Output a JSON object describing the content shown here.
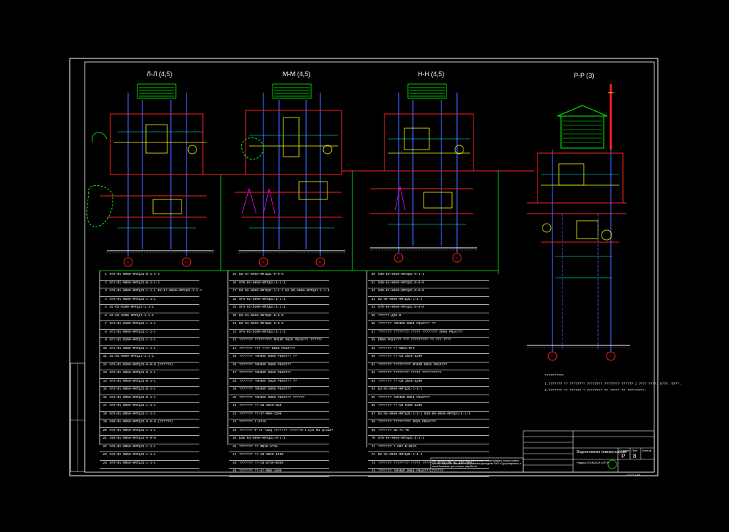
{
  "sections": [
    {
      "title": "Л-Л (4,5)"
    },
    {
      "title": "М-М (4,5)"
    },
    {
      "title": "Н-Н (4,5)"
    },
    {
      "title": "Р-Р (3)"
    }
  ],
  "axis_labels": [
    "12",
    "12",
    "13",
    "13",
    "11",
    "11",
    "7",
    "7"
  ],
  "legend_col1": [
    {
      "n": "1",
      "t": "070-01-0080-0М7Ц31-В-1-1-1"
    },
    {
      "n": "2",
      "t": "0Г2-01-0080-0М7Ц31-В-1-1-1"
    },
    {
      "n": "3",
      "t": "070-01-0080-0М7Ц31-1-1-1 Б2-07-0050-0М7Ц31-1-1-1"
    },
    {
      "n": "4",
      "t": "070-01-0080-0М7Ц31-1-1-1"
    },
    {
      "n": "5",
      "t": "Б2-01-0200-0М7Ц31-1-1-1"
    },
    {
      "n": "6",
      "t": "Б2-01-0200-0М7Ц31-1-1-1"
    },
    {
      "n": "7",
      "t": "0Г2-01-0100-0М7Ц31-1-1-1"
    },
    {
      "n": "8",
      "t": "0Г2-01-0080-0М7Ц31-1-1-1"
    },
    {
      "n": "9",
      "t": "0Г7-01-0200-0М7Ц31-1-1-1"
    },
    {
      "n": "10",
      "t": "0Г2-01-0080-0М7Ц31-1-1-1"
    },
    {
      "n": "11",
      "t": "Б2-01-0050-0М7Ц31-1-1-1"
    },
    {
      "n": "12",
      "t": "0Г6-01-0200-0М7Ц31-0-0-0 (??????)"
    },
    {
      "n": "13",
      "t": "0Г6-01-0050-0М7Ц31-В-1-1"
    },
    {
      "n": "14",
      "t": "0Г6-01-0050-0М7Ц31-В-1-1"
    },
    {
      "n": "15",
      "t": "0Г6-01-0050-0М7Ц31-В-1-1"
    },
    {
      "n": "16",
      "t": "0Г6-01-0050-0М7Ц31-В-1-1"
    },
    {
      "n": "17",
      "t": "070-01-0050-0М7Ц31-1-1-1"
    },
    {
      "n": "18",
      "t": "0Г8-01-0050-0М7Ц31-1-1-1"
    },
    {
      "n": "19",
      "t": "030-01-0050-0М7Ц31-0-0-0 (??????)"
    },
    {
      "n": "20",
      "t": "070-01-0050-0М7Ц31-1-1-1"
    },
    {
      "n": "21",
      "t": "030-01-0050-0М7Ц31-0-0-0"
    },
    {
      "n": "22",
      "t": "070-01-0050-0М7Ц31-1-1-1"
    },
    {
      "n": "23",
      "t": "0Г6-01-0050-0М7Ц31-1-1-1"
    },
    {
      "n": "24",
      "t": "070-01-0050-0М7Ц31-1-1-1"
    }
  ],
  "legend_col2": [
    {
      "n": "25",
      "t": "Б2-07-0050-0М7Ц31-0-0-0"
    },
    {
      "n": "26",
      "t": "070-01-0050-0М7Ц31-1-1-1"
    },
    {
      "n": "27",
      "t": "Б2-02-0050-0М7Ц31-1-1-1 Б2-02-0050-0М7Ц31-1-1-1"
    },
    {
      "n": "28",
      "t": "0Г6-01-0050-0М7Ц31-1-1-1"
    },
    {
      "n": "29",
      "t": "0Г6-01-0200-0М7Ц31-1-1-1"
    },
    {
      "n": "30",
      "t": "Б2-01-0050-0М7Ц31-0-0-0"
    },
    {
      "n": "31",
      "t": "Б2-01-0050-0М7Ц31-0-0-0"
    },
    {
      "n": "32",
      "t": "0Г6-01-0200-0М7Ц31-1-1-1"
    },
    {
      "n": "33",
      "t": "??????? ????????? 0П40П DN25 PN16??? ??????"
    },
    {
      "n": "34",
      "t": "??????? ??? ???? DN25 PN16???"
    },
    {
      "n": "35",
      "t": "??????? ?0П40П DN50 PN16??? ??"
    },
    {
      "n": "36",
      "t": "??????? ?0П40П DN50 PN16???"
    },
    {
      "n": "37",
      "t": "??????? ?0П40П DN20 PN16???"
    },
    {
      "n": "38",
      "t": "??????? ?0П40П DN20 PN16??? ??"
    },
    {
      "n": "39",
      "t": "??????? ?0П40П DN50 PN16???"
    },
    {
      "n": "40",
      "t": "??????? ?0П40П DN50 PN16??? ??????"
    },
    {
      "n": "41",
      "t": "??????? ??-СВ-3920-Б50"
    },
    {
      "n": "42",
      "t": "??????? ??-57-Ф80-1200"
    },
    {
      "n": "43",
      "t": "??????? С-5715"
    },
    {
      "n": "44",
      "t": "??????? Ф-?1-?12Ц ??????? 7??7??9-1 Ц=6 Ф1 Ц=125?"
    },
    {
      "n": "45",
      "t": "Б30-03-0050-0М7Ц31-0-1-1"
    },
    {
      "n": "46",
      "t": "??????? ?? ФВ15-5715"
    },
    {
      "n": "47",
      "t": "??????? ??-СВ-3920-1400"
    },
    {
      "n": "48",
      "t": "??????? ??-СВ-6730-Ф350"
    },
    {
      "n": "49",
      "t": "??????? ??-57-Ф80-1400"
    }
  ],
  "legend_col3": [
    {
      "n": "50",
      "t": "030-05-0050-0М7Ц31-0-1-1"
    },
    {
      "n": "51",
      "t": "030-02-0050-0М7Ц31-0-0-0"
    },
    {
      "n": "52",
      "t": "030-01-0050-0М7Ц31-0-0-0"
    },
    {
      "n": "53",
      "t": "Б2-06-0050-0М7Ц31-1-1-1"
    },
    {
      "n": "54",
      "t": "070-05-0050-0М7Ц31-0-0-0"
    },
    {
      "n": "55",
      "t": "??????-Д30-В"
    },
    {
      "n": "56",
      "t": "??????? ?0П40П DN50 PN16??? ??"
    },
    {
      "n": "57",
      "t": "??????? ???????? ????? ???????? DN50 PN16???"
    },
    {
      "n": "58",
      "t": "DN50 PN16??? ??? ????????? ?? ??? ????"
    },
    {
      "n": "59",
      "t": "??????? ??-5В04-Ф75"
    },
    {
      "n": "60",
      "t": "??????? ??-СВ-3920-1200"
    },
    {
      "n": "61",
      "t": "??????? ????????? 0П40П DN25 PN16???"
    },
    {
      "n": "62",
      "t": "??????? ???????? ????? ??????????"
    },
    {
      "n": "63",
      "t": "??????? ??-СВ-3920-1200"
    },
    {
      "n": "64",
      "t": "Б2-03-0050-0М7Ц31-1-1-1"
    },
    {
      "n": "65",
      "t": "??????? ?0П40П DN50 PN16???"
    },
    {
      "n": "66",
      "t": "??????? ??-СВ-0400-1200"
    },
    {
      "n": "67",
      "t": "Б2-05-0050-0М7Ц31-1-1-1 030-05-0050-0М7Ц31-1-1-1"
    },
    {
      "n": "68",
      "t": "??????? ????????? DN25 PN16???"
    },
    {
      "n": "69",
      "t": "??????? СВ-?1-?Б"
    },
    {
      "n": "70",
      "t": "070-05-0050-0М7Ц31-1-1-1"
    },
    {
      "n": "71",
      "t": "??????? ?-СВ?-В-В975"
    },
    {
      "n": "72",
      "t": "Б2-03-0050-0М7Ц31-1-1-1"
    },
    {
      "n": "73",
      "t": "??????? ???????? ????? ??????? Ф-25-40.Ч1 (0?18М?)"
    },
    {
      "n": "74",
      "t": "??????? ?0П40П DN50 PN16??? ??????"
    }
  ],
  "notes": {
    "title": "??????????",
    "line1": "1.??????? ?? ???????? ???????? ???????? ?????? 1 ???? ????. 8???. 5???.",
    "line2": "2.??????? ?? ?????? ? ???????? ?? ????? ?? ?????????."
  },
  "stamp": {
    "description": "Настоящий документ не может быть использован, воспроизведен, распространен третьим лицам без письменного разрешения руководства ПАО «Сургутнефтегаз», а также Заказчика, для которого разработан.",
    "code": "Радуга-ЛГОМ-В-Н-Н-Р-Р",
    "system": "Водоотливная компрессорная",
    "stage_header": "Стадия",
    "sheet_header": "Лист",
    "sheets_header": "Листов",
    "stage": "Р",
    "sheet": "8",
    "format": "?????? А3"
  },
  "colors": {
    "background": "#000000",
    "frame": "#ffffff",
    "pipe_red": "#ff2020",
    "pipe_green": "#00ff00",
    "pipe_yellow": "#ffff00",
    "pipe_blue": "#4060ff",
    "pipe_cyan": "#00ffff",
    "pipe_magenta": "#ff00ff"
  }
}
